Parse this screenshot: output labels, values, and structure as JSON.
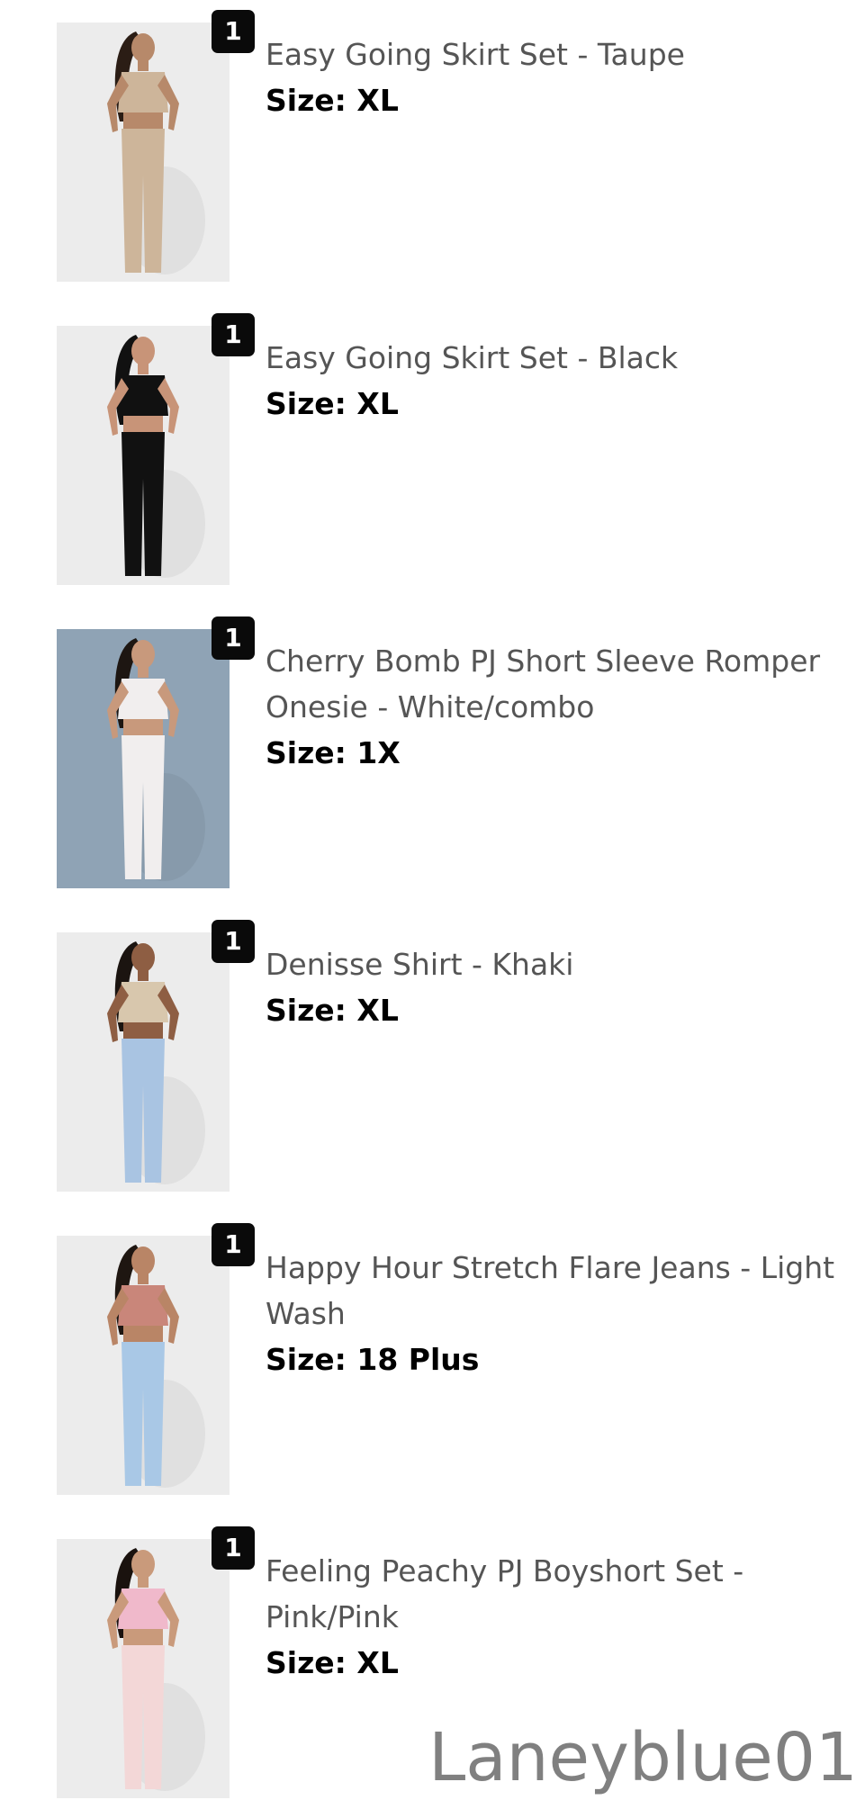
{
  "items": [
    {
      "quantity": "1",
      "name": "Easy Going Skirt Set - Taupe",
      "size_label": "Size:",
      "size_value": "XL",
      "colors": {
        "bg": "#ececec",
        "skin": "#b7896a",
        "top": "#cdb59a",
        "bottom": "#cdb59a",
        "hair": "#2b1d15"
      }
    },
    {
      "quantity": "1",
      "name": "Easy Going Skirt Set - Black",
      "size_label": "Size:",
      "size_value": "XL",
      "colors": {
        "bg": "#ececec",
        "skin": "#c89478",
        "top": "#111111",
        "bottom": "#111111",
        "hair": "#111111"
      }
    },
    {
      "quantity": "1",
      "name": "Cherry Bomb PJ Short Sleeve Romper Onesie - White/combo",
      "size_label": "Size:",
      "size_value": "1X",
      "colors": {
        "bg": "#8fa3b5",
        "skin": "#c8997c",
        "top": "#f1eeee",
        "bottom": "#f1eeee",
        "hair": "#1d1612"
      }
    },
    {
      "quantity": "1",
      "name": "Denisse Shirt - Khaki",
      "size_label": "Size:",
      "size_value": "XL",
      "colors": {
        "bg": "#ececec",
        "skin": "#8e5e43",
        "top": "#d8c7ad",
        "bottom": "#a9c4e2",
        "hair": "#1b1410"
      }
    },
    {
      "quantity": "1",
      "name": "Happy Hour Stretch Flare Jeans - Light Wash",
      "size_label": "Size:",
      "size_value": "18 Plus",
      "colors": {
        "bg": "#ececec",
        "skin": "#b98566",
        "top": "#c9867a",
        "bottom": "#a9c8e6",
        "hair": "#1e1611"
      }
    },
    {
      "quantity": "1",
      "name": "Feeling Peachy PJ Boyshort Set - Pink/Pink",
      "size_label": "Size:",
      "size_value": "XL",
      "colors": {
        "bg": "#ececec",
        "skin": "#c99a7b",
        "top": "#f0b9cb",
        "bottom": "#f3d7d7",
        "hair": "#1a120e"
      }
    }
  ],
  "watermark": "Laneyblue01"
}
